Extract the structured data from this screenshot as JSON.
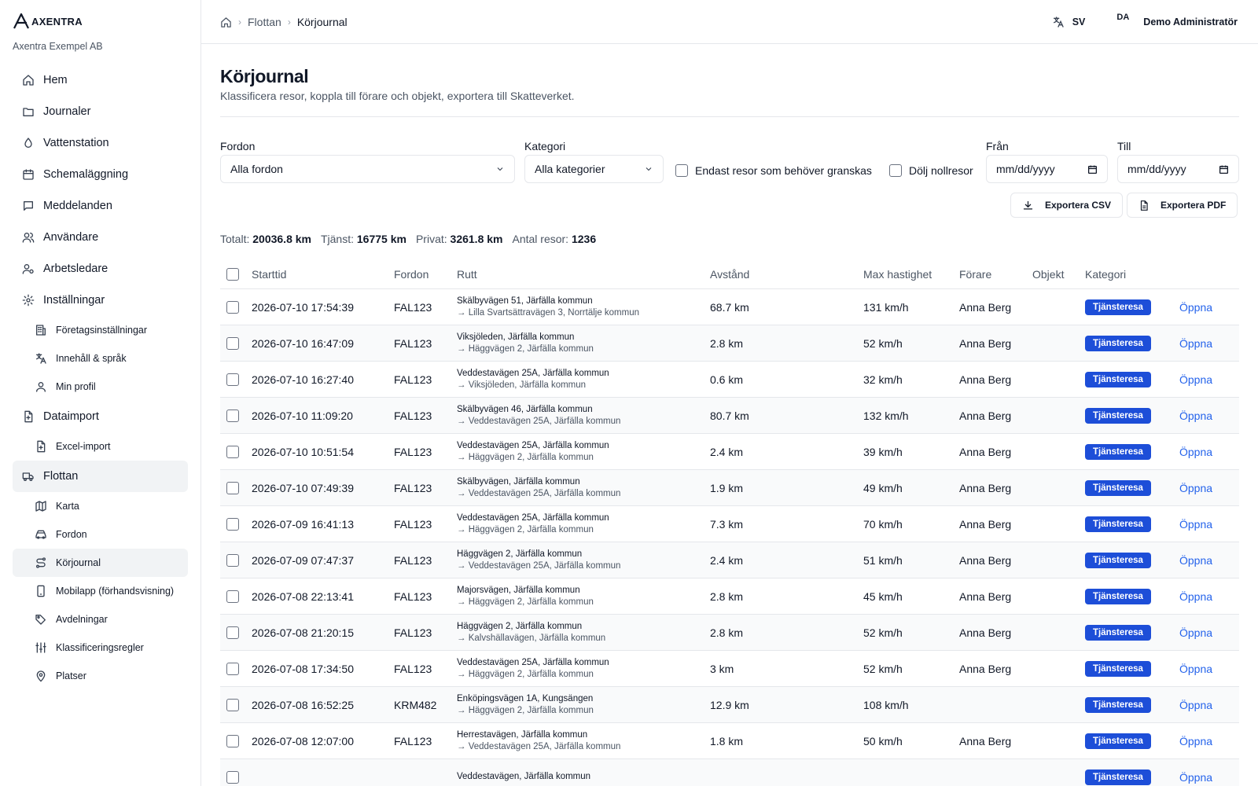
{
  "brand": {
    "name": "AXENTRA",
    "company": "Axentra Exempel AB"
  },
  "nav": [
    {
      "label": "Hem",
      "level": "top",
      "icon": "home-icon"
    },
    {
      "label": "Journaler",
      "level": "top",
      "icon": "folder-icon"
    },
    {
      "label": "Vattenstation",
      "level": "top",
      "icon": "droplet-icon"
    },
    {
      "label": "Schemaläggning",
      "level": "top",
      "icon": "calendar-icon"
    },
    {
      "label": "Meddelanden",
      "level": "top",
      "icon": "message-icon"
    },
    {
      "label": "Användare",
      "level": "top",
      "icon": "users-icon"
    },
    {
      "label": "Arbetsledare",
      "level": "top",
      "icon": "user-cog-icon"
    },
    {
      "label": "Inställningar",
      "level": "top",
      "icon": "gear-icon"
    },
    {
      "label": "Företagsinställningar",
      "level": "sub",
      "icon": "building-icon"
    },
    {
      "label": "Innehåll & språk",
      "level": "sub",
      "icon": "translate-icon"
    },
    {
      "label": "Min profil",
      "level": "sub",
      "icon": "user-icon"
    },
    {
      "label": "Dataimport",
      "level": "top",
      "icon": "file-import-icon"
    },
    {
      "label": "Excel-import",
      "level": "sub",
      "icon": "file-plus-icon"
    },
    {
      "label": "Flottan",
      "level": "top",
      "icon": "truck-icon",
      "active": true
    },
    {
      "label": "Karta",
      "level": "sub",
      "icon": "map-icon"
    },
    {
      "label": "Fordon",
      "level": "sub",
      "icon": "car-icon"
    },
    {
      "label": "Körjournal",
      "level": "sub",
      "icon": "route-icon",
      "active": true
    },
    {
      "label": "Mobilapp (förhandsvisning)",
      "level": "sub",
      "icon": "smartphone-icon"
    },
    {
      "label": "Avdelningar",
      "level": "sub",
      "icon": "tags-icon"
    },
    {
      "label": "Klassificeringsregler",
      "level": "sub",
      "icon": "sliders-icon"
    },
    {
      "label": "Platser",
      "level": "sub",
      "icon": "map-pin-icon"
    }
  ],
  "breadcrumb": {
    "items": [
      "Flottan",
      "Körjournal"
    ]
  },
  "topbar": {
    "language": "SV",
    "avatar_initials": "DA",
    "user_name": "Demo Administratör"
  },
  "page": {
    "title": "Körjournal",
    "subtitle": "Klassificera resor, koppla till förare och objekt, exportera till Skatteverket."
  },
  "filters": {
    "vehicle_label": "Fordon",
    "vehicle_value": "Alla fordon",
    "category_label": "Kategori",
    "category_value": "Alla kategorier",
    "review_only_label": "Endast resor som behöver granskas",
    "hide_zero_label": "Dölj nollresor",
    "from_label": "Från",
    "from_placeholder": "mm/dd/yyyy",
    "to_label": "Till",
    "to_placeholder": "mm/dd/yyyy"
  },
  "actions": {
    "export_csv": "Exportera CSV",
    "export_pdf": "Exportera PDF"
  },
  "summary": {
    "total_label": "Totalt:",
    "total_value": "20036.8 km",
    "service_label": "Tjänst:",
    "service_value": "16775 km",
    "private_label": "Privat:",
    "private_value": "3261.8 km",
    "trips_label": "Antal resor:",
    "trips_value": "1236"
  },
  "table": {
    "columns": [
      "Starttid",
      "Fordon",
      "Rutt",
      "Avstånd",
      "Max hastighet",
      "Förare",
      "Objekt",
      "Kategori"
    ],
    "open_label": "Öppna",
    "rows": [
      {
        "start": "2026-07-10 17:54:39",
        "vehicle": "FAL123",
        "from": "Skälbyvägen 51, Järfälla kommun",
        "to": "→ Lilla Svartsättravägen 3, Norrtälje kommun",
        "distance": "68.7 km",
        "max_speed": "131 km/h",
        "driver": "Anna Berg",
        "object": "",
        "category": "Tjänsteresa"
      },
      {
        "start": "2026-07-10 16:47:09",
        "vehicle": "FAL123",
        "from": "Viksjöleden, Järfälla kommun",
        "to": "→ Häggvägen 2, Järfälla kommun",
        "distance": "2.8 km",
        "max_speed": "52 km/h",
        "driver": "Anna Berg",
        "object": "",
        "category": "Tjänsteresa"
      },
      {
        "start": "2026-07-10 16:27:40",
        "vehicle": "FAL123",
        "from": "Veddestavägen 25A, Järfälla kommun",
        "to": "→ Viksjöleden, Järfälla kommun",
        "distance": "0.6 km",
        "max_speed": "32 km/h",
        "driver": "Anna Berg",
        "object": "",
        "category": "Tjänsteresa"
      },
      {
        "start": "2026-07-10 11:09:20",
        "vehicle": "FAL123",
        "from": "Skälbyvägen 46, Järfälla kommun",
        "to": "→ Veddestavägen 25A, Järfälla kommun",
        "distance": "80.7 km",
        "max_speed": "132 km/h",
        "driver": "Anna Berg",
        "object": "",
        "category": "Tjänsteresa"
      },
      {
        "start": "2026-07-10 10:51:54",
        "vehicle": "FAL123",
        "from": "Veddestavägen 25A, Järfälla kommun",
        "to": "→ Häggvägen 2, Järfälla kommun",
        "distance": "2.4 km",
        "max_speed": "39 km/h",
        "driver": "Anna Berg",
        "object": "",
        "category": "Tjänsteresa"
      },
      {
        "start": "2026-07-10 07:49:39",
        "vehicle": "FAL123",
        "from": "Skälbyvägen, Järfälla kommun",
        "to": "→ Veddestavägen 25A, Järfälla kommun",
        "distance": "1.9 km",
        "max_speed": "49 km/h",
        "driver": "Anna Berg",
        "object": "",
        "category": "Tjänsteresa"
      },
      {
        "start": "2026-07-09 16:41:13",
        "vehicle": "FAL123",
        "from": "Veddestavägen 25A, Järfälla kommun",
        "to": "→ Häggvägen 2, Järfälla kommun",
        "distance": "7.3 km",
        "max_speed": "70 km/h",
        "driver": "Anna Berg",
        "object": "",
        "category": "Tjänsteresa"
      },
      {
        "start": "2026-07-09 07:47:37",
        "vehicle": "FAL123",
        "from": "Häggvägen 2, Järfälla kommun",
        "to": "→ Veddestavägen 25A, Järfälla kommun",
        "distance": "2.4 km",
        "max_speed": "51 km/h",
        "driver": "Anna Berg",
        "object": "",
        "category": "Tjänsteresa"
      },
      {
        "start": "2026-07-08 22:13:41",
        "vehicle": "FAL123",
        "from": "Majorsvägen, Järfälla kommun",
        "to": "→ Häggvägen 2, Järfälla kommun",
        "distance": "2.8 km",
        "max_speed": "45 km/h",
        "driver": "Anna Berg",
        "object": "",
        "category": "Tjänsteresa"
      },
      {
        "start": "2026-07-08 21:20:15",
        "vehicle": "FAL123",
        "from": "Häggvägen 2, Järfälla kommun",
        "to": "→ Kalvshällavägen, Järfälla kommun",
        "distance": "2.8 km",
        "max_speed": "52 km/h",
        "driver": "Anna Berg",
        "object": "",
        "category": "Tjänsteresa"
      },
      {
        "start": "2026-07-08 17:34:50",
        "vehicle": "FAL123",
        "from": "Veddestavägen 25A, Järfälla kommun",
        "to": "→ Häggvägen 2, Järfälla kommun",
        "distance": "3 km",
        "max_speed": "52 km/h",
        "driver": "Anna Berg",
        "object": "",
        "category": "Tjänsteresa"
      },
      {
        "start": "2026-07-08 16:52:25",
        "vehicle": "KRM482",
        "from": "Enköpingsvägen 1A, Kungsängen",
        "to": "→ Häggvägen 2, Järfälla kommun",
        "distance": "12.9 km",
        "max_speed": "108 km/h",
        "driver": "",
        "object": "",
        "category": "Tjänsteresa"
      },
      {
        "start": "2026-07-08 12:07:00",
        "vehicle": "FAL123",
        "from": "Herrestavägen, Järfälla kommun",
        "to": "→ Veddestavägen 25A, Järfälla kommun",
        "distance": "1.8 km",
        "max_speed": "50 km/h",
        "driver": "Anna Berg",
        "object": "",
        "category": "Tjänsteresa"
      },
      {
        "start": "",
        "vehicle": "",
        "from": "Veddestavägen, Järfälla kommun",
        "to": "",
        "distance": "",
        "max_speed": "",
        "driver": "",
        "object": "",
        "category": "Tjänsteresa"
      }
    ]
  },
  "colors": {
    "accent": "#1d4ed8",
    "link": "#2563eb",
    "border": "#e5e7eb",
    "active_bg": "#f1f3f5"
  }
}
